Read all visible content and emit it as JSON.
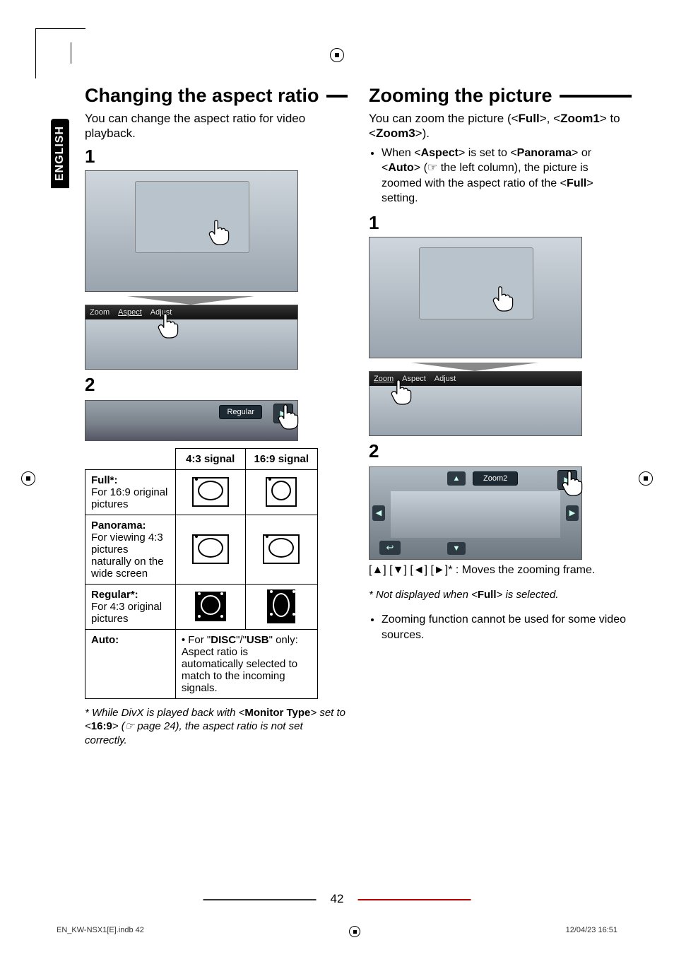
{
  "language_tab": "ENGLISH",
  "page_number": "42",
  "footer_left": "EN_KW-NSX1[E].indb   42",
  "footer_right": "12/04/23   16:51",
  "left": {
    "heading": "Changing the aspect ratio",
    "lead": "You can change the aspect ratio for video playback.",
    "step1": "1",
    "toolbar": {
      "zoom": "Zoom",
      "aspect": "Aspect",
      "adjust": "Adjust"
    },
    "step2": "2",
    "strip_label": "Regular",
    "table": {
      "col1": "4:3 signal",
      "col2": "16:9 signal",
      "rows": [
        {
          "name": "Full*:",
          "desc": "For 16:9 original pictures"
        },
        {
          "name": "Panorama:",
          "desc": "For viewing 4:3 pictures naturally on the wide screen"
        },
        {
          "name": "Regular*:",
          "desc": "For 4:3 original pictures"
        },
        {
          "name": "Auto:",
          "auto": "For \"DISC\"/\"USB\" only: Aspect ratio is automatically selected to match to the incoming signals."
        }
      ]
    },
    "footnote_pre": "* While DivX is played back with <",
    "footnote_b1": "Monitor Type",
    "footnote_mid": "> set to <",
    "footnote_b2": "16:9",
    "footnote_post": "> (☞ page 24), the aspect ratio is not set correctly."
  },
  "right": {
    "heading": "Zooming the picture",
    "lead_pre": "You can zoom the picture (<",
    "lead_b1": "Full",
    "lead_mid1": ">, <",
    "lead_b2": "Zoom1",
    "lead_mid2": "> to <",
    "lead_b3": "Zoom3",
    "lead_post": ">).",
    "bullet1_pre": "When <",
    "bullet1_b1": "Aspect",
    "bullet1_mid1": "> is set to <",
    "bullet1_b2": "Panorama",
    "bullet1_mid2": "> or <",
    "bullet1_b3": "Auto",
    "bullet1_mid3": "> (☞ the left column), the picture is zoomed with the aspect ratio of the <",
    "bullet1_b4": "Full",
    "bullet1_post": "> setting.",
    "step1": "1",
    "toolbar": {
      "zoom": "Zoom",
      "aspect": "Aspect",
      "adjust": "Adjust"
    },
    "step2": "2",
    "zoom_label": "Zoom2",
    "caption": "[▲] [▼] [◄] [►]* : Moves the zooming frame.",
    "footnote_pre": "* Not displayed when <",
    "footnote_b": "Full",
    "footnote_post": "> is selected.",
    "bullet2": "Zooming function cannot be used for some video sources."
  }
}
